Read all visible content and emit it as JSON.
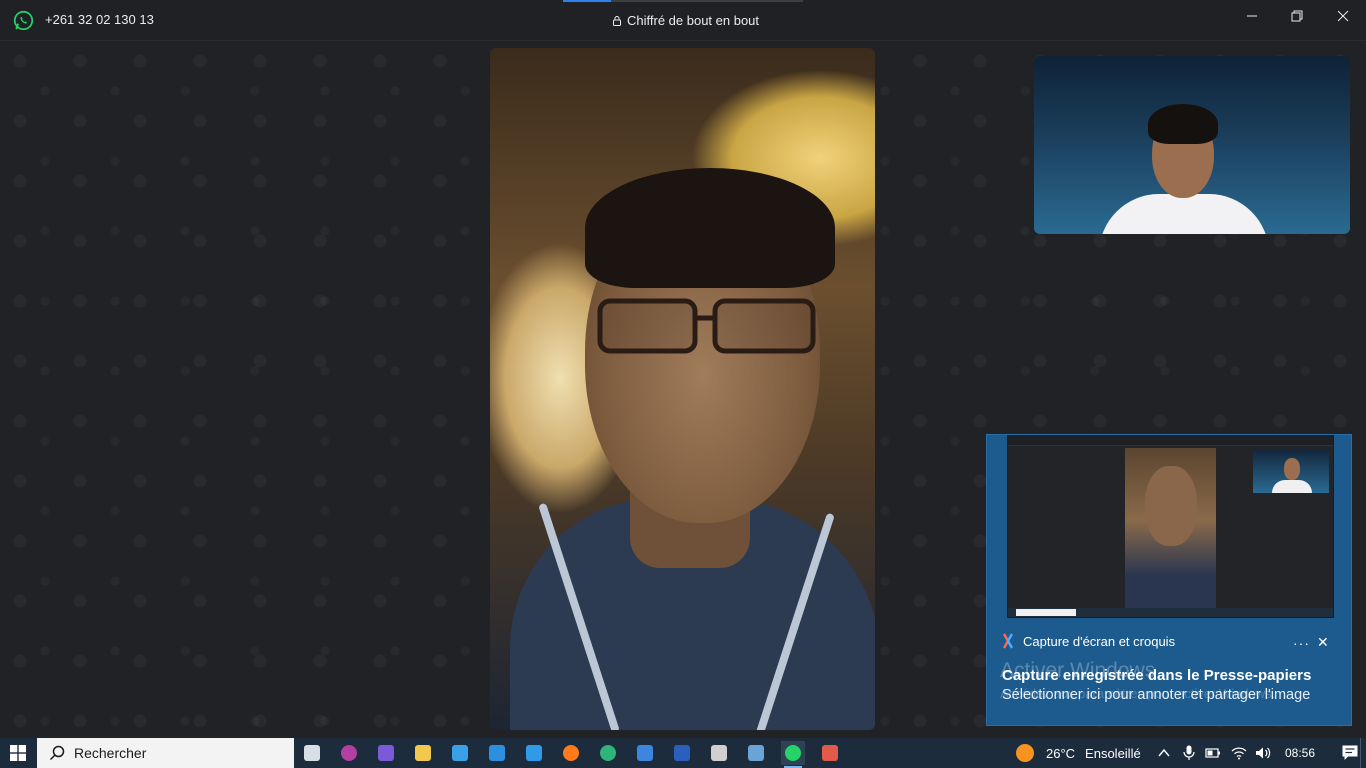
{
  "titlebar": {
    "contact_number": "+261 32 02 130 13",
    "encryption_text": "Chiffré de bout en bout",
    "call_progress_fraction": 0.2
  },
  "toast": {
    "app_name": "Capture d'écran et croquis",
    "title": "Capture enregistrée dans le Presse-papiers",
    "body": "Sélectionner ici pour annoter et partager l'image",
    "more_label": "···",
    "close_label": "✕"
  },
  "watermark": {
    "line1": "Activer Windows",
    "line2": "Accédez aux paramètres pour activer Windows."
  },
  "taskbar": {
    "search_placeholder": "Rechercher",
    "weather_temp": "26°C",
    "weather_text": "Ensoleillé",
    "clock": "08:56",
    "pinned_apps": [
      {
        "icon": "task-view-icon",
        "color": "#d8dfe6"
      },
      {
        "icon": "app-purple-icon",
        "color": "#b43fa3"
      },
      {
        "icon": "app-stripe-icon",
        "color": "#7a5ad6"
      },
      {
        "icon": "file-explorer-icon",
        "color": "#f2c94c"
      },
      {
        "icon": "store-icon",
        "color": "#3aa0e8"
      },
      {
        "icon": "mail-icon",
        "color": "#2d8fe0"
      },
      {
        "icon": "vscode-icon",
        "color": "#2f9be8"
      },
      {
        "icon": "firefox-icon",
        "color": "#ff7a1a"
      },
      {
        "icon": "edge-icon",
        "color": "#2fb47a"
      },
      {
        "icon": "visual-studio-icon",
        "color": "#3d86e0"
      },
      {
        "icon": "word-icon",
        "color": "#2b5fbd"
      },
      {
        "icon": "terminal-icon",
        "color": "#cfcfcf"
      },
      {
        "icon": "postgres-icon",
        "color": "#6aa3d6"
      },
      {
        "icon": "whatsapp-icon",
        "color": "#25d366"
      },
      {
        "icon": "snip-sketch-icon",
        "color": "#e25b4a"
      }
    ]
  },
  "colors": {
    "accent": "#2f80ed",
    "toast_bg": "#1d5b8f",
    "whatsapp": "#25d366"
  }
}
